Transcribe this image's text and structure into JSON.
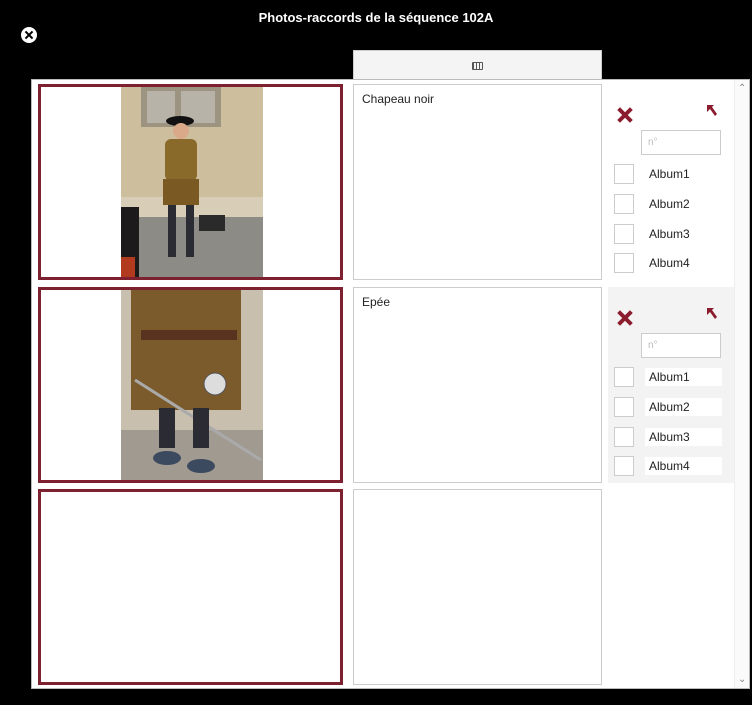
{
  "window": {
    "title": "Photos-raccords de la séquence 102A"
  },
  "tabs": [
    {
      "icon": "keyboard-icon"
    }
  ],
  "rows": [
    {
      "description": "Chapeau noir",
      "number_placeholder": "n°",
      "albums": [
        "Album1",
        "Album2",
        "Album3",
        "Album4"
      ]
    },
    {
      "description": "Epée",
      "number_placeholder": "n°",
      "albums": [
        "Album1",
        "Album2",
        "Album3",
        "Album4"
      ]
    },
    {
      "description": ""
    }
  ],
  "colors": {
    "accent": "#7d2030",
    "delete": "#8b1c2e",
    "background": "#000000"
  }
}
